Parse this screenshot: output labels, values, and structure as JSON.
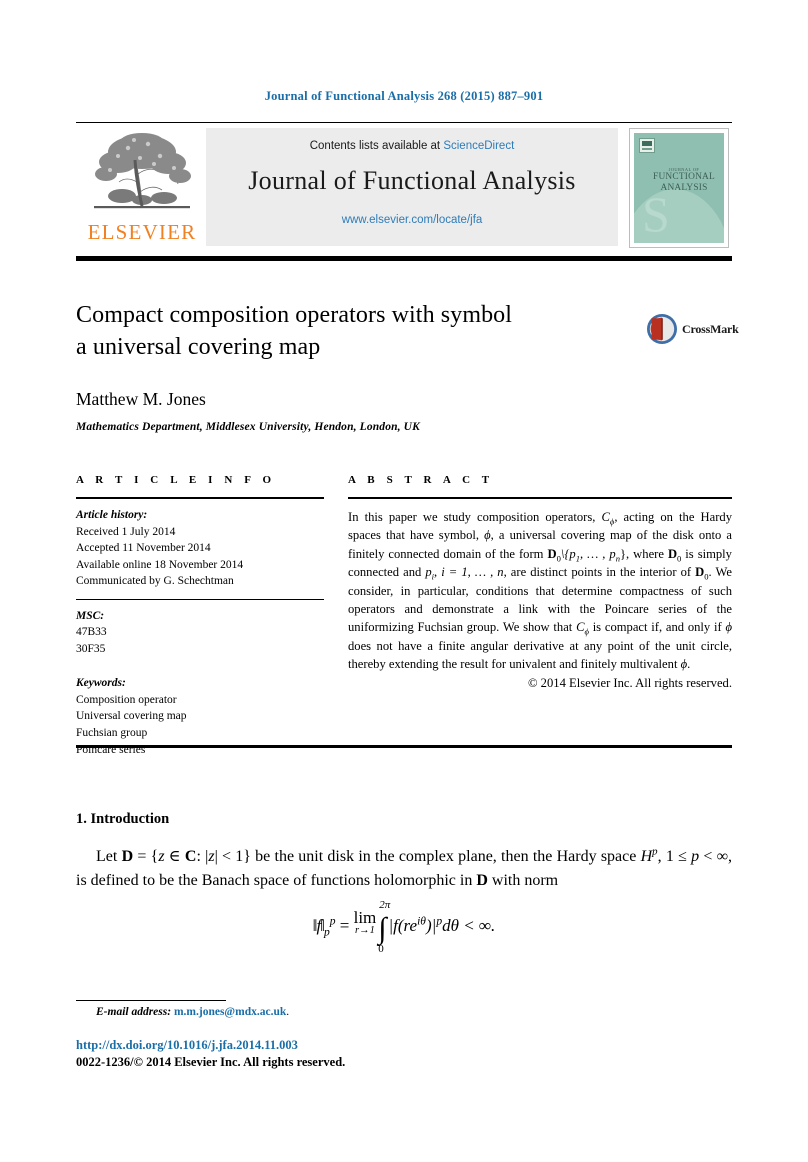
{
  "header": {
    "running_head": "Journal of Functional Analysis 268 (2015) 887–901"
  },
  "masthead": {
    "contents_prefix": "Contents lists available at ",
    "sciencedirect": "ScienceDirect",
    "journal_name": "Journal of Functional Analysis",
    "journal_url": "www.elsevier.com/locate/jfa",
    "publisher_logo_text": "ELSEVIER",
    "publisher_logo_icon": "elsevier-tree-icon",
    "cover": {
      "line1": "JOURNAL OF",
      "line2": "FUNCTIONAL",
      "line3": "ANALYSIS",
      "accent_color": "#8fbfb0"
    }
  },
  "article": {
    "title_line1": "Compact composition operators with symbol",
    "title_line2": "a universal covering map",
    "author": "Matthew M. Jones",
    "affiliation": "Mathematics Department, Middlesex University, Hendon, London, UK",
    "crossmark_label": "CrossMark"
  },
  "info": {
    "label": "A R T I C L E    I N F O",
    "history_label": "Article history:",
    "history": [
      "Received 1 July 2014",
      "Accepted 11 November 2014",
      "Available online 18 November 2014",
      "Communicated by G. Schechtman"
    ],
    "msc_label": "MSC:",
    "msc": [
      "47B33",
      "30F35"
    ],
    "keywords_label": "Keywords:",
    "keywords": [
      "Composition operator",
      "Universal covering map",
      "Fuchsian group",
      "Poincare series"
    ]
  },
  "abstract": {
    "label": "A B S T R A C T",
    "text_part1": "In this paper we study composition operators, ",
    "math_Cphi_1": "C",
    "math_phi_1": "ϕ",
    "text_part2": ", acting on the Hardy spaces that have symbol, ",
    "math_phi_2": "ϕ",
    "text_part3": ", a universal covering map of the disk onto a finitely connected domain of the form ",
    "math_domain": "D",
    "math_domain_sub": "0",
    "math_set": "\\{p",
    "math_set_sub1": "1",
    "math_set_mid": ", … , p",
    "math_set_sub2": "n",
    "math_set_close": "}",
    "text_part4": ", where ",
    "math_domain2": "D",
    "math_domain2_sub": "0",
    "text_part5": " is simply connected and ",
    "math_pi": "p",
    "math_pi_sub": "i",
    "text_part6": ", ",
    "math_i_eq": "i = 1, … , n",
    "text_part7": ", are distinct points in the interior of ",
    "math_domain3": "D",
    "math_domain3_sub": "0",
    "text_part8": ". We consider, in particular, conditions that determine compactness of such operators and demonstrate a link with the Poincare series of the uniformizing Fuchsian group. We show that ",
    "math_Cphi_2": "C",
    "math_phi_3": "ϕ",
    "text_part9": " is compact if, and only if ",
    "math_phi_4": "ϕ",
    "text_part10": " does not have a finite angular derivative at any point of the unit circle, thereby extending the result for univalent and finitely multivalent ",
    "math_phi_5": "ϕ",
    "text_part11": ".",
    "copyright": "© 2014 Elsevier Inc. All rights reserved."
  },
  "body": {
    "section_number_title": "1.  Introduction",
    "para_a": "Let ",
    "para_disk": "D",
    "para_b": " = {",
    "para_z1": "z",
    "para_c": " ∈ ",
    "para_C": "C",
    "para_d": ": |",
    "para_z2": "z",
    "para_e": "| < 1} be the unit disk in the complex plane, then the Hardy space ",
    "para_H": "H",
    "para_Hsup": "p",
    "para_f": ", 1 ≤ ",
    "para_p": "p",
    "para_g": " < ∞, is defined to be the Banach space of functions holomorphic in ",
    "para_disk2": "D",
    "para_h": " with norm",
    "equation": {
      "lhs_norm": "‖f‖",
      "lhs_sub": "p",
      "lhs_sup": "p",
      "eq": " = ",
      "lim": "lim",
      "lim_sub": "r→1",
      "int_upper": "2π",
      "int_lower": "0",
      "integrand_open": "|f(re",
      "integrand_sup": "iθ",
      "integrand_close": ")|",
      "integrand_power": "p",
      "measure": "dθ < ∞."
    }
  },
  "footer": {
    "email_label": "E-mail address:",
    "email": "m.m.jones@mdx.ac.uk",
    "email_period": ".",
    "doi": "http://dx.doi.org/10.1016/j.jfa.2014.11.003",
    "issn_copyright": "0022-1236/© 2014 Elsevier Inc. All rights reserved.",
    "link_color": "#1a6ea8"
  }
}
